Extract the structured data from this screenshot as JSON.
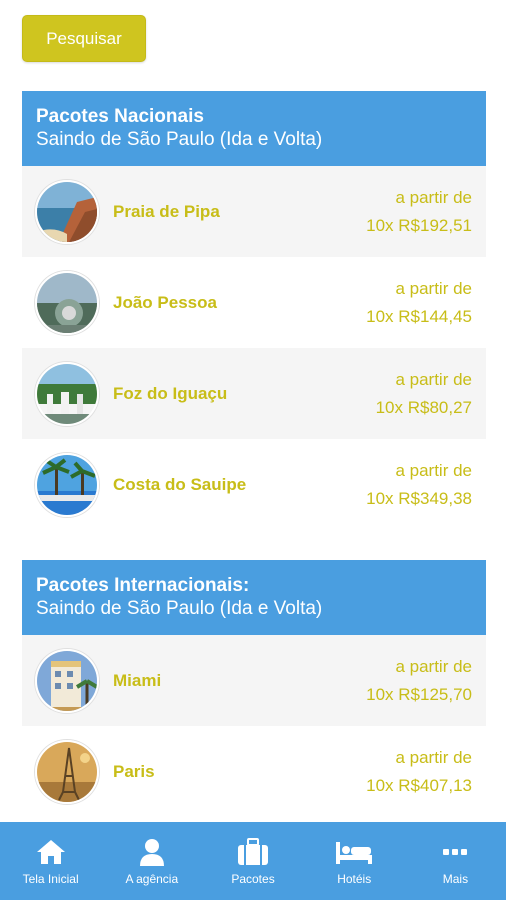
{
  "search": {
    "label": "Pesquisar"
  },
  "national": {
    "title": "Pacotes Nacionais",
    "subtitle": "Saindo de São Paulo (Ida e Volta)",
    "items": [
      {
        "name": "Praia de Pipa",
        "from": "a partir de",
        "price": "10x R$192,51"
      },
      {
        "name": "João Pessoa",
        "from": "a partir de",
        "price": "10x R$144,45"
      },
      {
        "name": "Foz do Iguaçu",
        "from": "a partir de",
        "price": "10x R$80,27"
      },
      {
        "name": "Costa do Sauipe",
        "from": "a partir de",
        "price": "10x R$349,38"
      }
    ]
  },
  "international": {
    "title": "Pacotes Internacionais:",
    "subtitle": "Saindo de São Paulo (Ida e Volta)",
    "items": [
      {
        "name": "Miami",
        "from": "a partir de",
        "price": "10x R$125,70"
      },
      {
        "name": "Paris",
        "from": "a partir de",
        "price": "10x R$407,13"
      }
    ]
  },
  "nav": [
    {
      "label": "Tela Inicial",
      "icon": "home-icon"
    },
    {
      "label": "A agência",
      "icon": "user-icon"
    },
    {
      "label": "Pacotes",
      "icon": "suitcase-icon"
    },
    {
      "label": "Hotéis",
      "icon": "bed-icon"
    },
    {
      "label": "Mais",
      "icon": "more-icon"
    }
  ],
  "colors": {
    "accent_yellow": "#cfc51f",
    "header_blue": "#4a9ee0"
  }
}
